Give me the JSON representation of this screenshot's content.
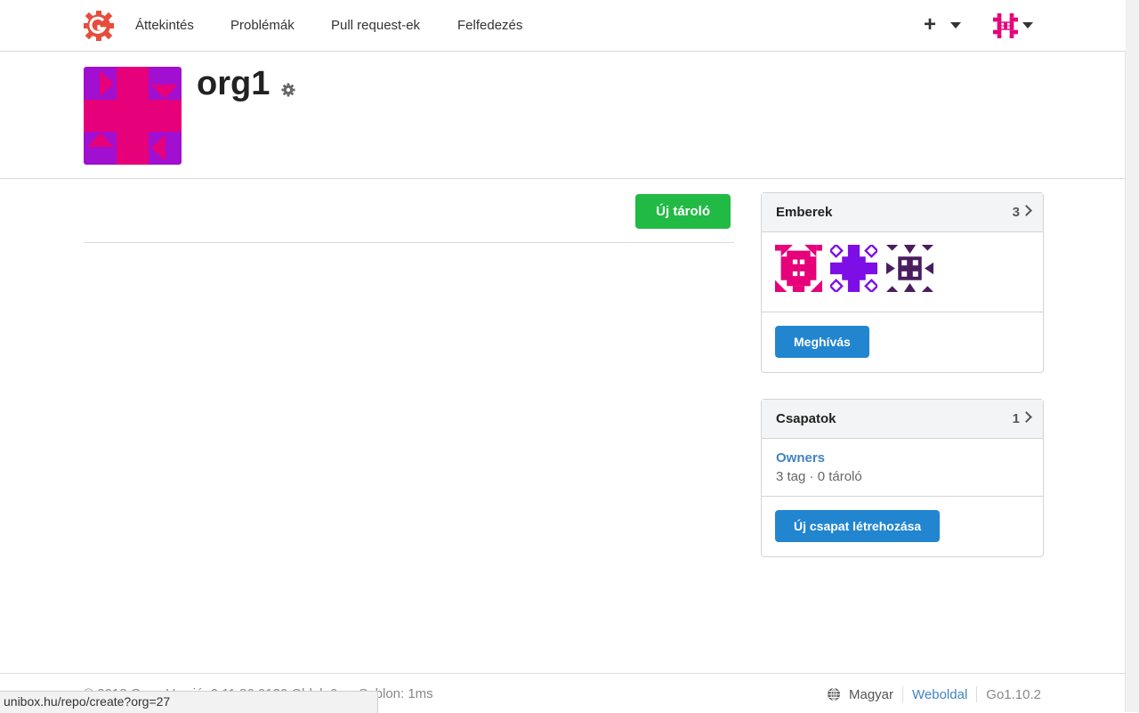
{
  "nav": {
    "items": [
      "Áttekintés",
      "Problémák",
      "Pull request-ek",
      "Felfedezés"
    ],
    "plus": "+"
  },
  "org": {
    "name": "org1"
  },
  "main": {
    "new_repo_label": "Új tároló"
  },
  "people": {
    "title": "Emberek",
    "count": "3",
    "invite_label": "Meghívás"
  },
  "teams": {
    "title": "Csapatok",
    "count": "1",
    "team_name": "Owners",
    "team_meta": "3 tag · 0 tároló",
    "create_label": "Új csapat létrehozása"
  },
  "footer": {
    "left": "© 2018 Gogs Verzió: 0.11.86.0130 Oldal: 6ms Sablon: 1ms",
    "language": "Magyar",
    "website": "Weboldal",
    "go_version": "Go1.10.2"
  },
  "status_bar": {
    "url": "unibox.hu/repo/create?org=27"
  },
  "colors": {
    "accent_green": "#21ba45",
    "accent_blue": "#2185d0",
    "link_blue": "#4183c4",
    "brand_red": "#e74c3c"
  }
}
